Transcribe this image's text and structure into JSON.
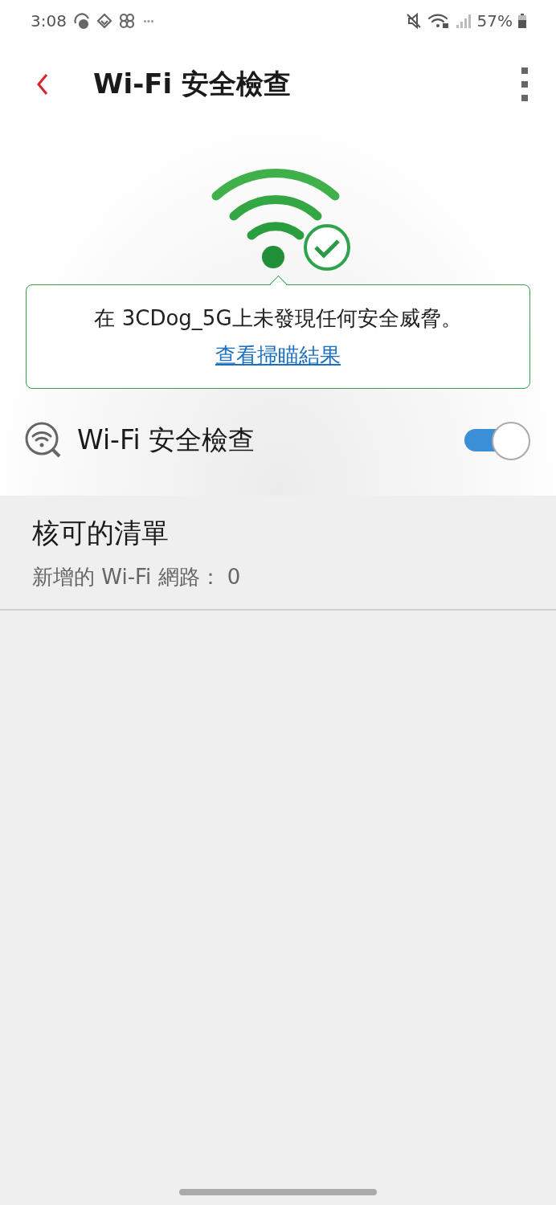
{
  "status_bar": {
    "time": "3:08",
    "battery": "57%"
  },
  "header": {
    "title": "Wi-Fi 安全檢查"
  },
  "result": {
    "message": "在 3CDog_5G上未發現任何安全威脅。",
    "link": "查看掃瞄結果"
  },
  "toggle": {
    "label": "Wi-Fi 安全檢查",
    "on": true
  },
  "approved_list": {
    "title": "核可的清單",
    "subtitle": "新增的 Wi-Fi 網路： 0"
  }
}
